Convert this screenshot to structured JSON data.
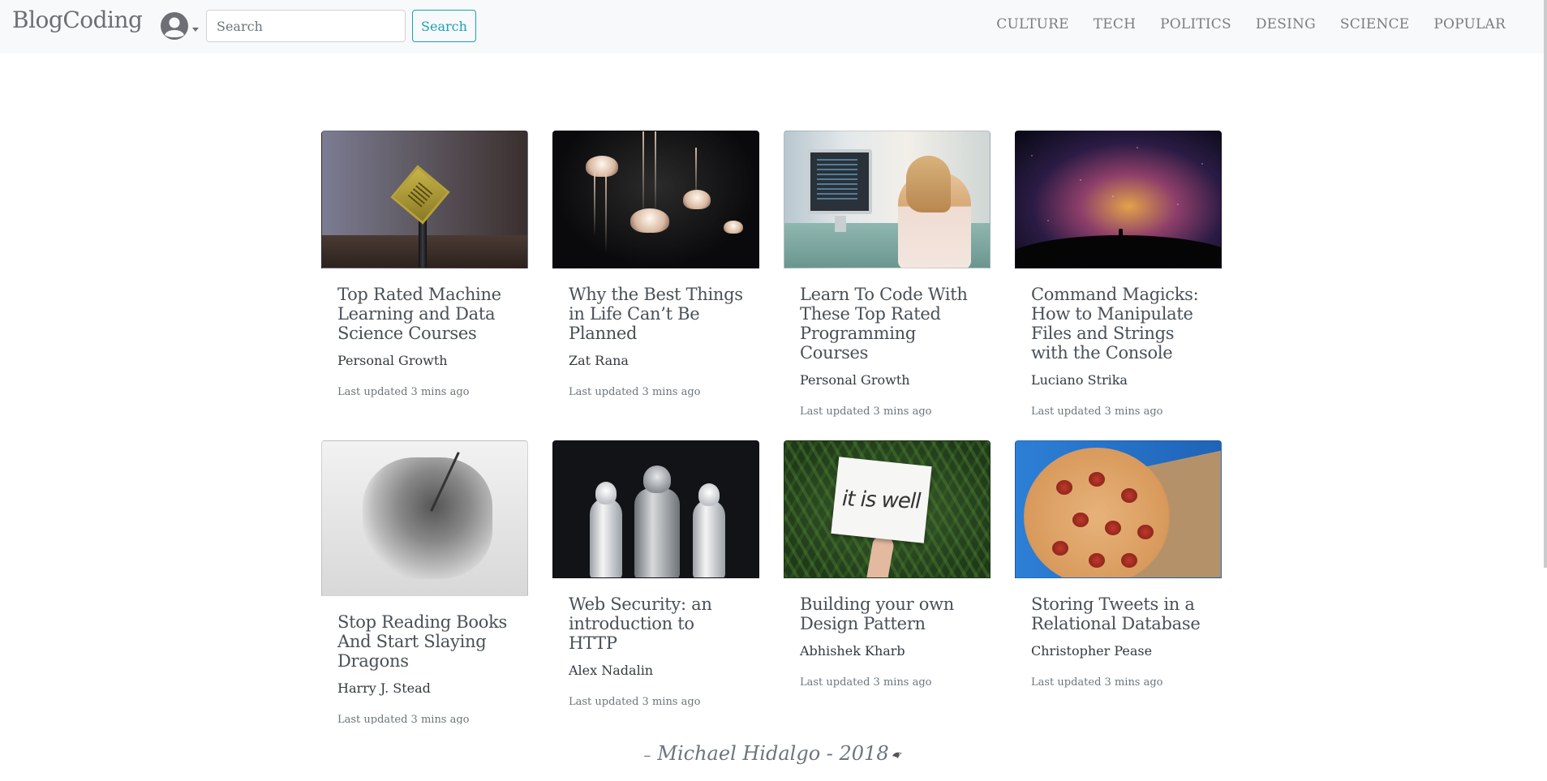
{
  "navbar": {
    "brand": "BlogCoding",
    "search_placeholder": "Search",
    "search_button": "Search",
    "links": [
      "CULTURE",
      "TECH",
      "POLITICS",
      "DESING",
      "SCIENCE",
      "POPULAR"
    ]
  },
  "cards": [
    {
      "title": "Top Rated Machine Learning and Data Science Courses",
      "author": "Personal Growth",
      "updated": "Last updated 3 mins ago",
      "image": "cpu-chip-on-pin"
    },
    {
      "title": "Why the Best Things in Life Can’t Be Planned",
      "author": "Zat Rana",
      "updated": "Last updated 3 mins ago",
      "image": "jellyfish"
    },
    {
      "title": "Learn To Code With These Top Rated Programming Courses",
      "author": "Personal Growth",
      "updated": "Last updated 3 mins ago",
      "image": "woman-coding-at-computer"
    },
    {
      "title": "Command Magicks: How to Manipulate Files and Strings with the Console",
      "author": "Luciano Strika",
      "updated": "Last updated 3 mins ago",
      "image": "milky-way-galaxy"
    },
    {
      "title": "Stop Reading Books And Start Slaying Dragons",
      "author": "Harry J. Stead",
      "updated": "Last updated 3 mins ago",
      "image": "knight-slaying-dragon-engraving"
    },
    {
      "title": "Web Security: an introduction to HTTP",
      "author": "Alex Nadalin",
      "updated": "Last updated 3 mins ago",
      "image": "stormtroopers"
    },
    {
      "title": "Building your own Design Pattern",
      "author": "Abhishek Kharb",
      "updated": "Last updated 3 mins ago",
      "image": "it-is-well-sign",
      "sign_text": "it is well"
    },
    {
      "title": "Storing Tweets in a Relational Database",
      "author": "Christopher Pease",
      "updated": "Last updated 3 mins ago",
      "image": "pepperoni-pizza"
    }
  ],
  "footer": {
    "dash": "–",
    "text": "Michael Hidalgo - 2018"
  },
  "colors": {
    "navbar_bg": "#f8f9fa",
    "accent": "#17a2b8",
    "brand": "#6c6f73",
    "muted": "#6c757d"
  }
}
